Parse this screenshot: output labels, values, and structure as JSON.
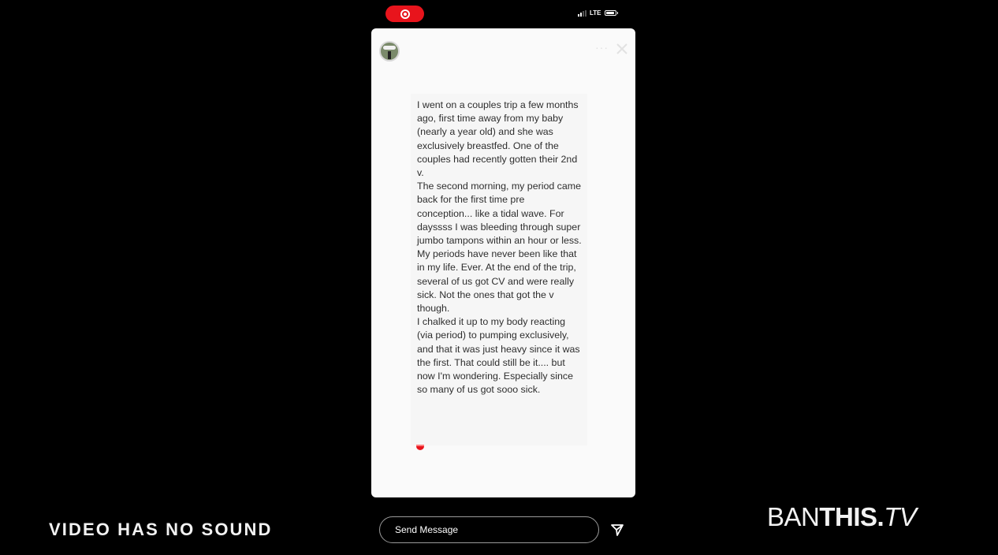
{
  "status_bar": {
    "network": "LTE"
  },
  "story": {
    "username": "",
    "message": "I went on a couples trip a few months ago, first time away from my baby (nearly a year old) and she was exclusively breastfed. One of the couples had recently gotten their 2nd v.\nThe second morning, my period came back for the first time pre conception... like a tidal wave. For dayssss I was bleeding through super jumbo tampons within an hour or less. My periods have never been like that in my life. Ever. At the end of the trip, several of us got CV and were really sick. Not the ones that got the v though.\nI chalked it up to my body reacting (via period) to pumping exclusively, and that it was just heavy since it was the first. That could still be it.... but now I'm wondering. Especially since so many of us got sooo sick.",
    "more_icon": "more-dots-icon",
    "close_icon": "close-icon"
  },
  "reply": {
    "placeholder": "Send Message",
    "send_icon": "send-icon"
  },
  "overlay": {
    "no_sound": "VIDEO HAS NO SOUND",
    "logo_part1": "BAN",
    "logo_part2": "THIS.",
    "logo_part3": "TV"
  },
  "colors": {
    "background": "#000000",
    "record_red": "#e8141c",
    "story_bg": "#fafafa"
  }
}
